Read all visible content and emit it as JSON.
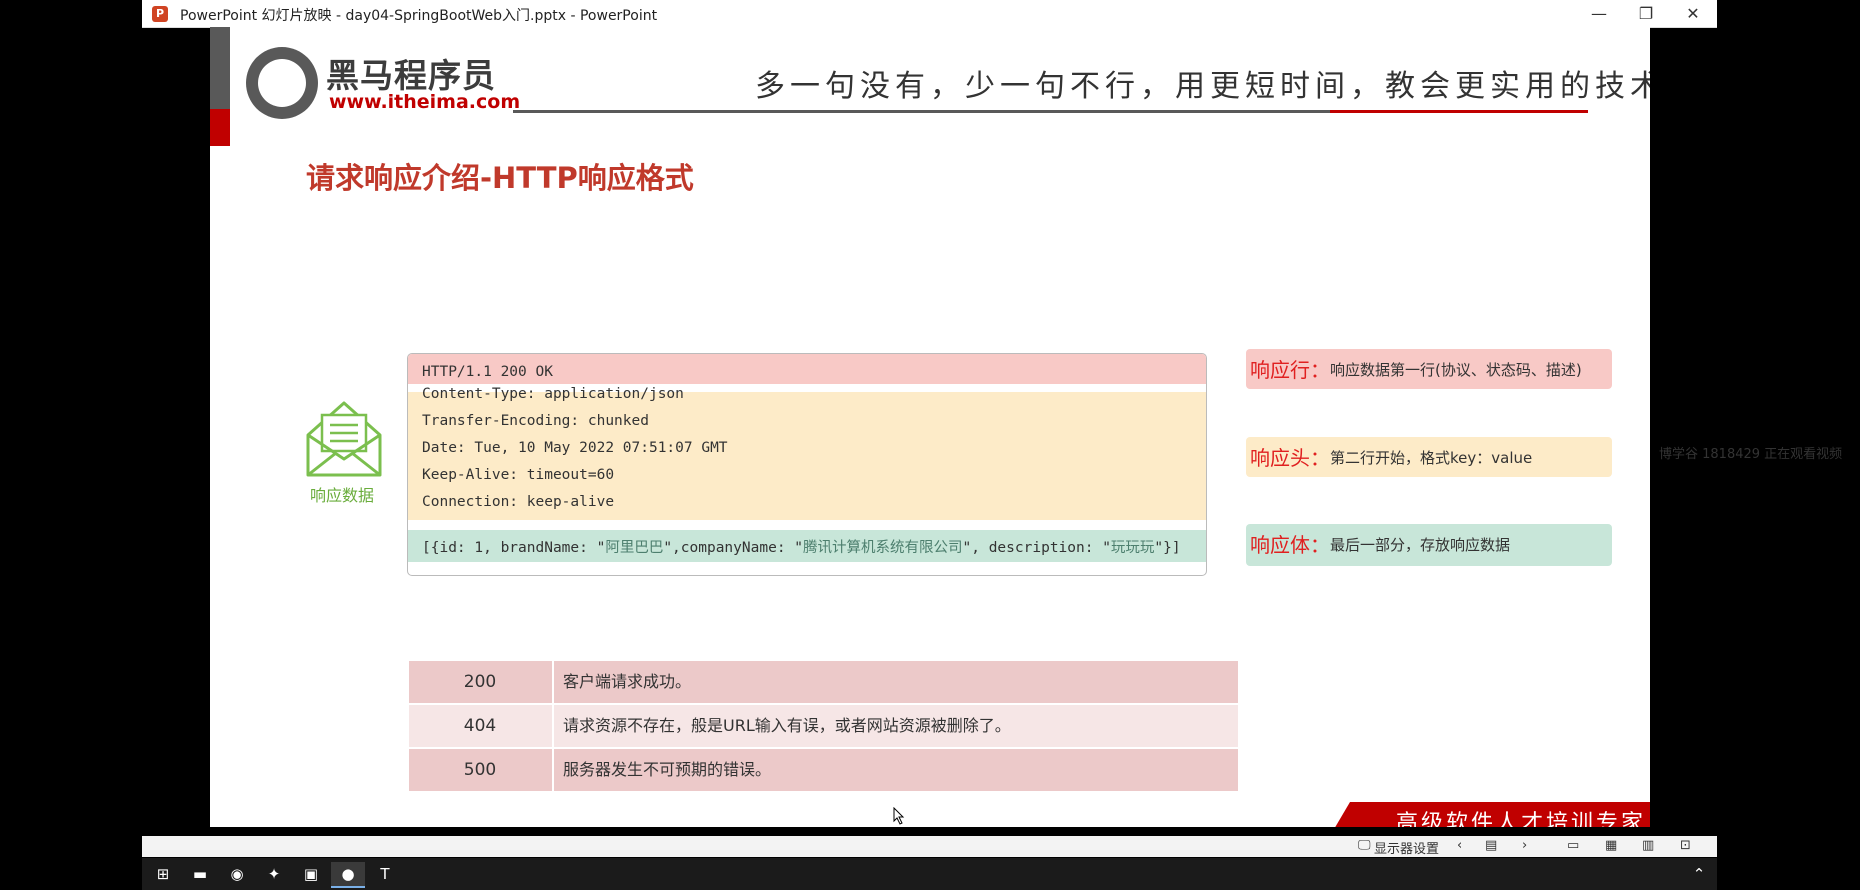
{
  "window": {
    "title": "PowerPoint 幻灯片放映  -  day04-SpringBootWeb入门.pptx - PowerPoint",
    "app_icon": "P",
    "controls": {
      "minimize": "—",
      "restore": "❐",
      "close": "✕"
    }
  },
  "slide": {
    "logo": {
      "name": "黑马程序员",
      "url": "www.itheima.com"
    },
    "slogan": "多一句没有，少一句不行，用更短时间，教会更实用的技术!",
    "title": "请求响应介绍-HTTP响应格式",
    "envelope_label": "响应数据",
    "response": {
      "status_line": "HTTP/1.1 200 OK",
      "headers": [
        "Content-Type: application/json",
        "Transfer-Encoding: chunked",
        "Date: Tue, 10 May 2022 07:51:07 GMT",
        "Keep-Alive: timeout=60",
        "Connection: keep-alive"
      ],
      "body": {
        "p1": "[{id: 1, brandName: \"",
        "v1": "阿里巴巴",
        "p2": "\",companyName: \"",
        "v2": "腾讯计算机系统有限公司",
        "p3": "\", description: \"",
        "v3": "玩玩玩",
        "p4": "\"}]"
      }
    },
    "labels": [
      {
        "key": "响应行",
        "sep": "：",
        "text": "响应数据第一行(协议、状态码、描述)",
        "color": "#f8c9c6"
      },
      {
        "key": "响应头",
        "sep": "：",
        "text": "第二行开始，格式key：value",
        "color": "#fdebc8"
      },
      {
        "key": "响应体",
        "sep": "：",
        "text": "最后一部分，存放响应数据",
        "color": "#c8e6d9"
      }
    ],
    "status_codes": [
      {
        "code": "200",
        "desc": "客户端请求成功。"
      },
      {
        "code": "404",
        "desc": "请求资源不存在，般是URL输入有误，或者网站资源被删除了。"
      },
      {
        "code": "500",
        "desc": "服务器发生不可预期的错误。"
      }
    ],
    "banner": "高级软件人才培训专家"
  },
  "watermark": "博学谷 1818429 正在观看视频",
  "statusbar": {
    "display_settings": "显示器设置"
  },
  "taskbar": {
    "items": [
      "start",
      "file-explorer",
      "chrome",
      "app",
      "intellij",
      "powerpoint",
      "typora"
    ]
  }
}
